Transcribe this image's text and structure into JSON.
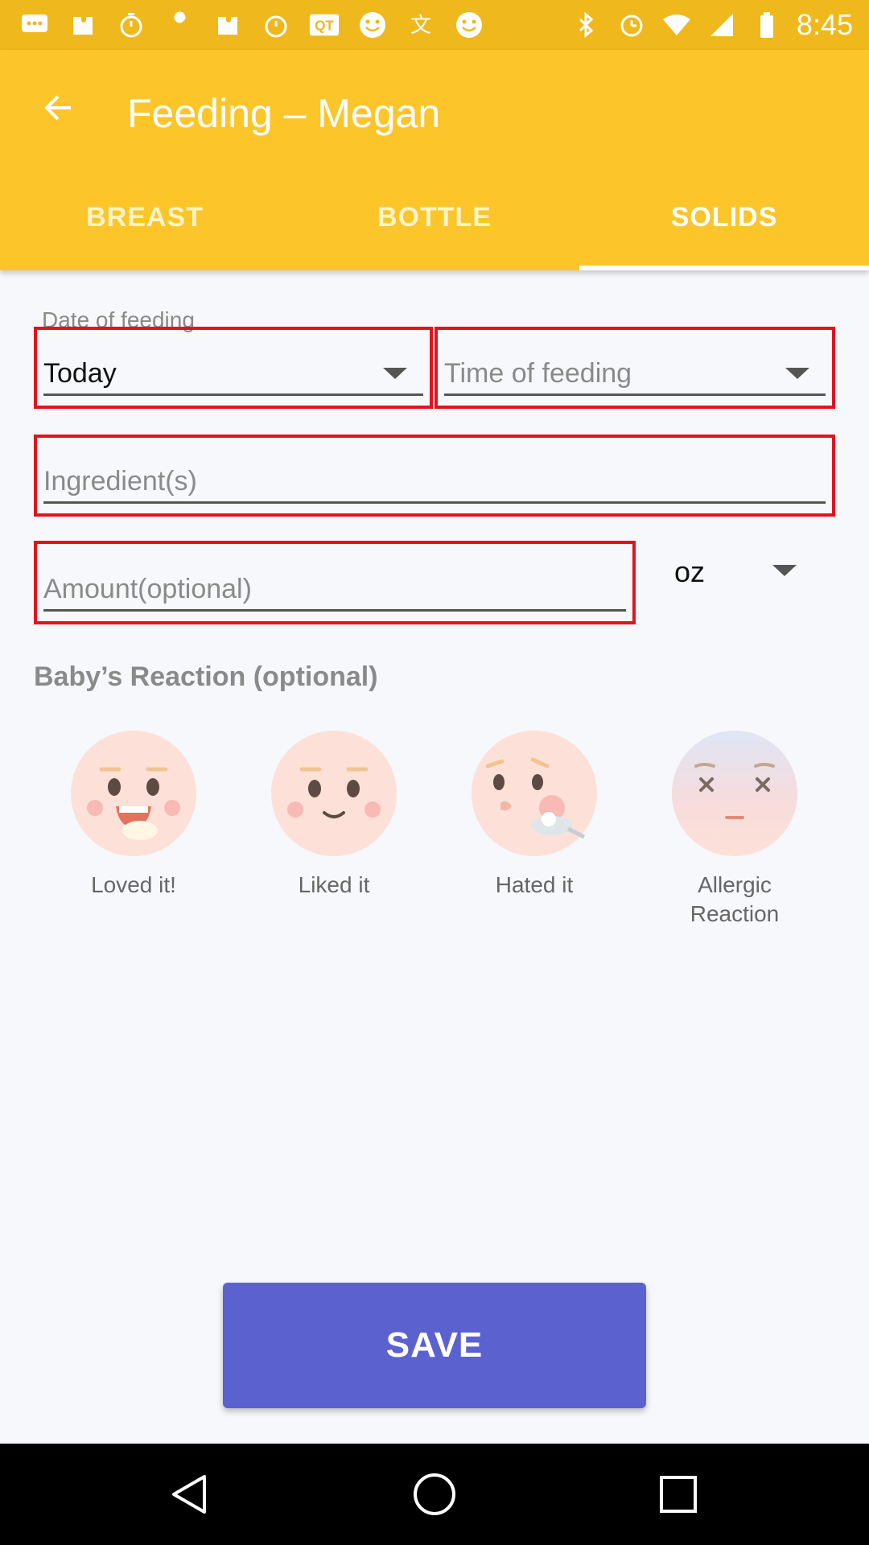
{
  "status_bar": {
    "time": "8:45",
    "left_icons": [
      "chat-icon",
      "puzzle-icon",
      "timer-icon",
      "wrench-icon",
      "puzzle-icon",
      "timer-icon",
      "qr-icon",
      "smiley-icon",
      "translate-icon",
      "smiley-icon"
    ],
    "right_icons": [
      "bluetooth-icon",
      "alarm-icon",
      "wifi-icon",
      "signal-icon",
      "battery-icon"
    ]
  },
  "app_bar": {
    "title": "Feeding – Megan",
    "tabs": [
      {
        "label": "BREAST",
        "active": false
      },
      {
        "label": "BOTTLE",
        "active": false
      },
      {
        "label": "SOLIDS",
        "active": true
      }
    ]
  },
  "form": {
    "date_label": "Date of feeding",
    "date_value": "Today",
    "time_placeholder": "Time of feeding",
    "ingredients_placeholder": "Ingredient(s)",
    "amount_placeholder": "Amount(optional)",
    "unit_value": "oz"
  },
  "reaction": {
    "title": "Baby’s Reaction (optional)",
    "options": [
      {
        "label": "Loved it!",
        "icon": "loved-face-icon"
      },
      {
        "label": "Liked it",
        "icon": "liked-face-icon"
      },
      {
        "label": "Hated it",
        "icon": "hated-face-icon"
      },
      {
        "label": "Allergic Reaction",
        "icon": "allergic-face-icon"
      }
    ]
  },
  "save_label": "SAVE",
  "colors": {
    "status_bar": "#efb81d",
    "app_bar": "#fcc62a",
    "save_button": "#5b62d0",
    "highlight_border": "#e0141e"
  }
}
